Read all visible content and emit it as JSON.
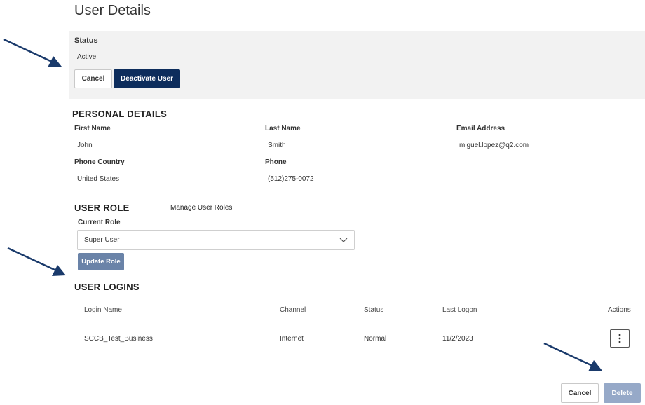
{
  "page": {
    "title": "User Details"
  },
  "status_section": {
    "label": "Status",
    "value": "Active",
    "cancel_label": "Cancel",
    "deactivate_label": "Deactivate User"
  },
  "personal_details": {
    "heading": "PERSONAL DETAILS",
    "first_name_label": "First Name",
    "first_name": "John",
    "last_name_label": "Last Name",
    "last_name": "Smith",
    "email_label": "Email Address",
    "email": "miguel.lopez@q2.com",
    "phone_country_label": "Phone Country",
    "phone_country": "United States",
    "phone_label": "Phone",
    "phone": "(512)275-0072"
  },
  "user_role": {
    "heading": "USER ROLE",
    "manage_link": "Manage User Roles",
    "current_role_label": "Current Role",
    "current_role": "Super User",
    "update_label": "Update Role"
  },
  "user_logins": {
    "heading": "USER LOGINS",
    "columns": [
      "Login Name",
      "Channel",
      "Status",
      "Last Logon",
      "Actions"
    ],
    "rows": [
      {
        "login_name": "SCCB_Test_Business",
        "channel": "Internet",
        "status": "Normal",
        "last_logon": "11/2/2023"
      }
    ]
  },
  "footer": {
    "cancel_label": "Cancel",
    "delete_label": "Delete"
  },
  "icons": {
    "chevron": "chevron-down-icon",
    "kebab": "vertical-ellipsis-icon",
    "arrow": "annotation-arrow"
  },
  "colors": {
    "primary": "#0d2d5c",
    "secondary": "#6a83a8",
    "disabled": "#96a9c8",
    "panel": "#f2f2f2",
    "arrow": "#1a3a6b"
  }
}
